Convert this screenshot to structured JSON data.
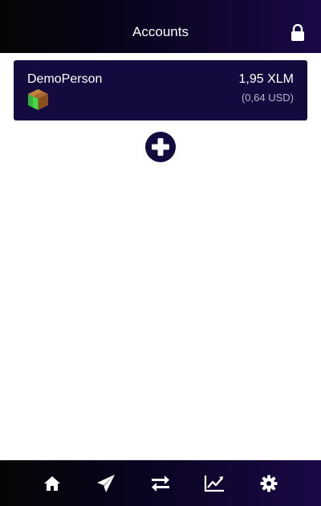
{
  "header": {
    "title": "Accounts",
    "lock_icon": "lock-icon"
  },
  "accounts": [
    {
      "name": "DemoPerson",
      "balance": "1,95 XLM",
      "fiat": "(0,64 USD)",
      "avatar_icon": "cube-avatar-icon"
    }
  ],
  "actions": {
    "add_icon": "plus-circle-icon"
  },
  "bottom_nav": {
    "items": [
      {
        "id": "home",
        "icon": "home-icon"
      },
      {
        "id": "send",
        "icon": "paper-plane-icon"
      },
      {
        "id": "exchange",
        "icon": "swap-arrows-icon"
      },
      {
        "id": "chart",
        "icon": "line-chart-icon"
      },
      {
        "id": "settings",
        "icon": "gear-icon"
      }
    ]
  },
  "colors": {
    "header_gradient_start": "#050505",
    "header_gradient_end": "#1a0846",
    "card_background": "#140a3d",
    "fiat_text": "#b8b3cc",
    "background": "#ffffff"
  }
}
